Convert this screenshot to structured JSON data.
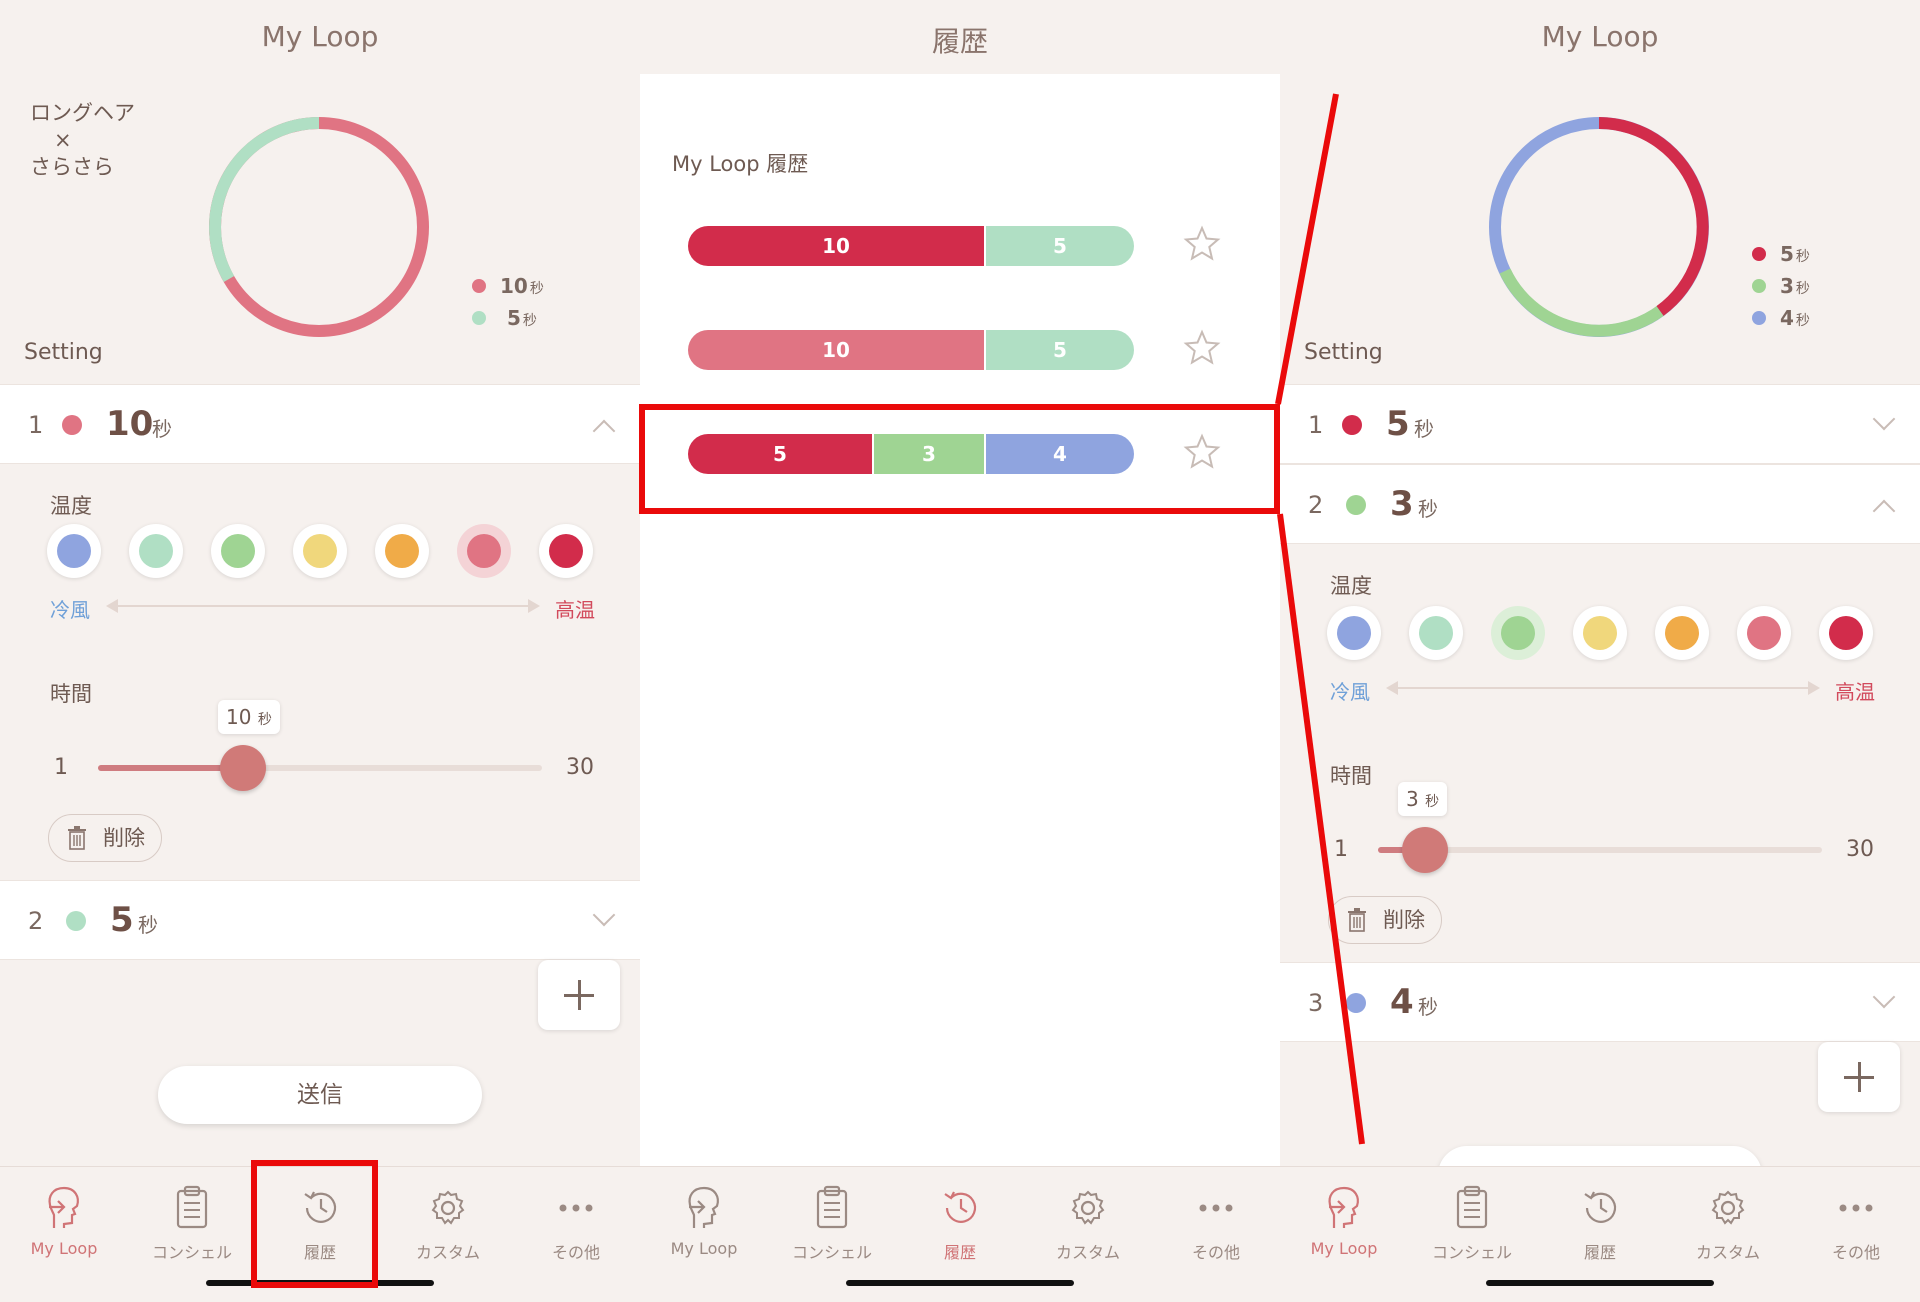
{
  "colors": {
    "cold_blue": "#8fa4df",
    "mint": "#b0dfc4",
    "green": "#9fd493",
    "yellow": "#f0d77c",
    "orange": "#f0ab48",
    "pink": "#e07483",
    "crimson": "#d22c4b",
    "accent": "#d07476",
    "annotation_red": "#ea0a0a"
  },
  "left": {
    "title": "My Loop",
    "preset_name_1": "ロングヘア",
    "preset_times": "×",
    "preset_name_2": "さらさら",
    "legend": [
      {
        "value": "10",
        "unit": "秒",
        "color": "#e07483"
      },
      {
        "value": "5",
        "unit": "秒",
        "color": "#b0dfc4"
      }
    ],
    "setting_label": "Setting",
    "step1": {
      "num": "1",
      "value": "10",
      "unit": "秒"
    },
    "temp_label": "温度",
    "cold_label": "冷風",
    "hot_label": "高温",
    "time_label": "時間",
    "slider": {
      "min": "1",
      "max": "30",
      "tip_value": "10",
      "tip_unit": "秒",
      "value": 10
    },
    "delete_label": "削除",
    "step2": {
      "num": "2",
      "value": "5",
      "unit": "秒"
    },
    "send_label": "送信"
  },
  "middle": {
    "title": "履歴",
    "history_title": "My Loop 履歴",
    "rows": [
      {
        "segments": [
          {
            "label": "10",
            "color": "#d22c4b"
          },
          {
            "label": "5",
            "color": "#b0dfc4"
          }
        ]
      },
      {
        "segments": [
          {
            "label": "10",
            "color": "#e07483"
          },
          {
            "label": "5",
            "color": "#b0dfc4"
          }
        ]
      },
      {
        "segments": [
          {
            "label": "5",
            "color": "#d22c4b"
          },
          {
            "label": "3",
            "color": "#9fd493"
          },
          {
            "label": "4",
            "color": "#8fa4df"
          }
        ]
      }
    ]
  },
  "right": {
    "title": "My Loop",
    "legend": [
      {
        "value": "5",
        "unit": "秒",
        "color": "#d22c4b"
      },
      {
        "value": "3",
        "unit": "秒",
        "color": "#9fd493"
      },
      {
        "value": "4",
        "unit": "秒",
        "color": "#8fa4df"
      }
    ],
    "setting_label": "Setting",
    "step1": {
      "num": "1",
      "value": "5",
      "unit": "秒"
    },
    "step2": {
      "num": "2",
      "value": "3",
      "unit": "秒"
    },
    "temp_label": "温度",
    "cold_label": "冷風",
    "hot_label": "高温",
    "time_label": "時間",
    "slider": {
      "min": "1",
      "max": "30",
      "tip_value": "3",
      "tip_unit": "秒",
      "value": 3
    },
    "delete_label": "削除",
    "step3": {
      "num": "3",
      "value": "4",
      "unit": "秒"
    }
  },
  "tabs": [
    {
      "label": "My Loop",
      "icon": "my-loop-head-icon"
    },
    {
      "label": "コンシェル",
      "icon": "clipboard-icon"
    },
    {
      "label": "履歴",
      "icon": "history-clock-icon"
    },
    {
      "label": "カスタム",
      "icon": "gear-icon"
    },
    {
      "label": "その他",
      "icon": "more-dots-icon"
    }
  ]
}
